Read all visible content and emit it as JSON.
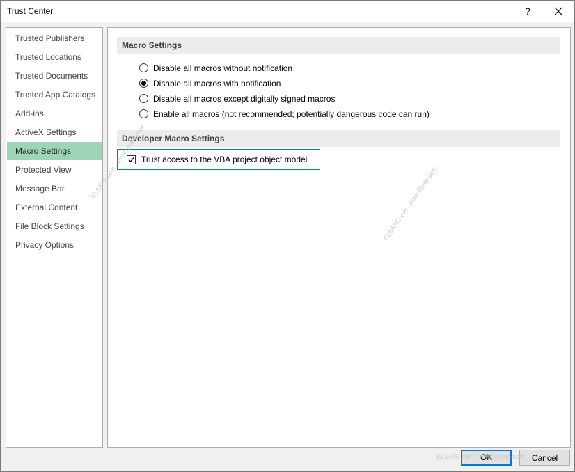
{
  "window": {
    "title": "Trust Center",
    "help_label": "?"
  },
  "nav": {
    "items": [
      {
        "label": "Trusted Publishers"
      },
      {
        "label": "Trusted Locations"
      },
      {
        "label": "Trusted Documents"
      },
      {
        "label": "Trusted App Catalogs"
      },
      {
        "label": "Add-ins"
      },
      {
        "label": "ActiveX Settings"
      },
      {
        "label": "Macro Settings",
        "selected": true
      },
      {
        "label": "Protected View"
      },
      {
        "label": "Message Bar"
      },
      {
        "label": "External Content"
      },
      {
        "label": "File Block Settings"
      },
      {
        "label": "Privacy Options"
      }
    ]
  },
  "macro_settings": {
    "header": "Macro Settings",
    "options": [
      {
        "label": "Disable all macros without notification",
        "checked": false
      },
      {
        "label": "Disable all macros with notification",
        "checked": true
      },
      {
        "label": "Disable all macros except digitally signed macros",
        "checked": false
      },
      {
        "label": "Enable all macros (not recommended; potentially dangerous code can run)",
        "checked": false
      }
    ]
  },
  "developer_settings": {
    "header": "Developer Macro Settings",
    "vba_label": "Trust access to the VBA project object model",
    "vba_checked": true
  },
  "buttons": {
    "ok": "OK",
    "cancel": "Cancel"
  },
  "watermark": {
    "text": "ELSATE.com - www.elsate.com"
  },
  "colors": {
    "selected_nav": "#9fd5b7",
    "focus_border": "#0078d7"
  }
}
